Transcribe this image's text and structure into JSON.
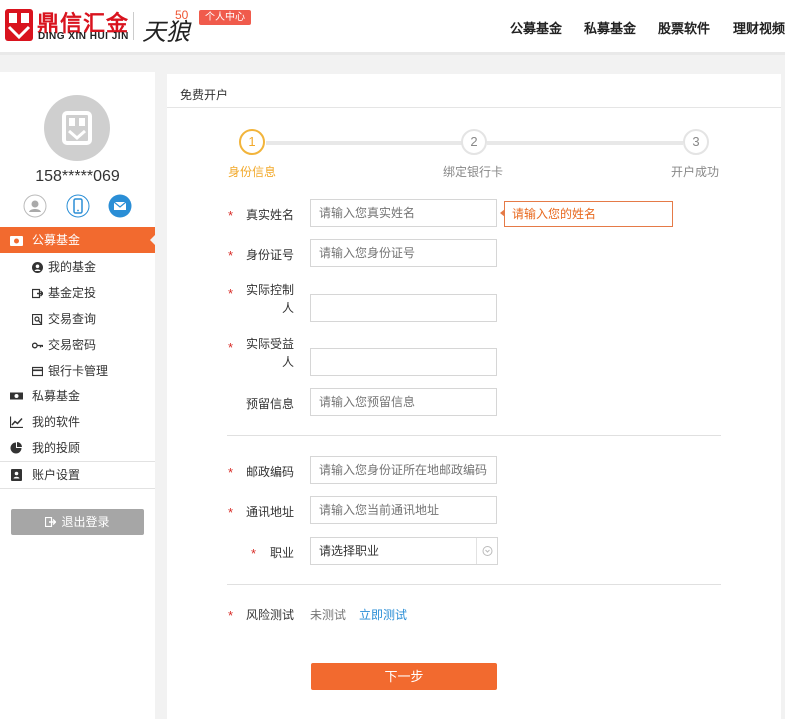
{
  "header": {
    "logo_cn": "鼎信汇金",
    "logo_en": "DING XIN HUI JIN",
    "brand_script": "天狼",
    "brand_number": "50",
    "personal_center": "个人中心",
    "nav": [
      "公募基金",
      "私募基金",
      "股票软件",
      "理财视频"
    ]
  },
  "sidebar": {
    "phone": "158*****069",
    "quick_icons": [
      "user-icon",
      "mobile-icon",
      "mail-icon"
    ],
    "menu": {
      "public_fund": "公募基金",
      "sub_items": [
        {
          "label": "我的基金",
          "icon": "user-circle-icon"
        },
        {
          "label": "基金定投",
          "icon": "share-icon"
        },
        {
          "label": "交易查询",
          "icon": "search-doc-icon"
        },
        {
          "label": "交易密码",
          "icon": "key-icon"
        },
        {
          "label": "银行卡管理",
          "icon": "card-icon"
        }
      ],
      "private_fund": "私募基金",
      "my_software": "我的软件",
      "my_advisor": "我的投顾",
      "account_settings": "账户设置"
    },
    "logout": "退出登录"
  },
  "main": {
    "breadcrumb": "免费开户",
    "steps": [
      {
        "number": "1",
        "label": "身份信息",
        "active": true
      },
      {
        "number": "2",
        "label": "绑定银行卡",
        "active": false
      },
      {
        "number": "3",
        "label": "开户成功",
        "active": false
      }
    ],
    "required_mark": "*",
    "form": {
      "real_name": {
        "label": "真实姓名",
        "placeholder": "请输入您真实姓名",
        "error": "请输入您的姓名"
      },
      "id_number": {
        "label": "身份证号",
        "placeholder": "请输入您身份证号"
      },
      "actual_controller": {
        "label": "实际控制人",
        "placeholder": ""
      },
      "actual_beneficiary": {
        "label": "实际受益人",
        "placeholder": ""
      },
      "reserved_info": {
        "label": "预留信息",
        "placeholder": "请输入您预留信息"
      },
      "postal_code": {
        "label": "邮政编码",
        "placeholder": "请输入您身份证所在地邮政编码"
      },
      "address": {
        "label": "通讯地址",
        "placeholder": "请输入您当前通讯地址"
      },
      "occupation": {
        "label": "职业",
        "value": "请选择职业"
      },
      "risk_test": {
        "label": "风险测试",
        "status": "未测试",
        "link": "立即测试"
      }
    },
    "next_button": "下一步"
  },
  "colors": {
    "accent": "#f26a2f",
    "brand_red": "#d9131e",
    "step_active": "#f2b43b",
    "link": "#2a8ed6"
  }
}
